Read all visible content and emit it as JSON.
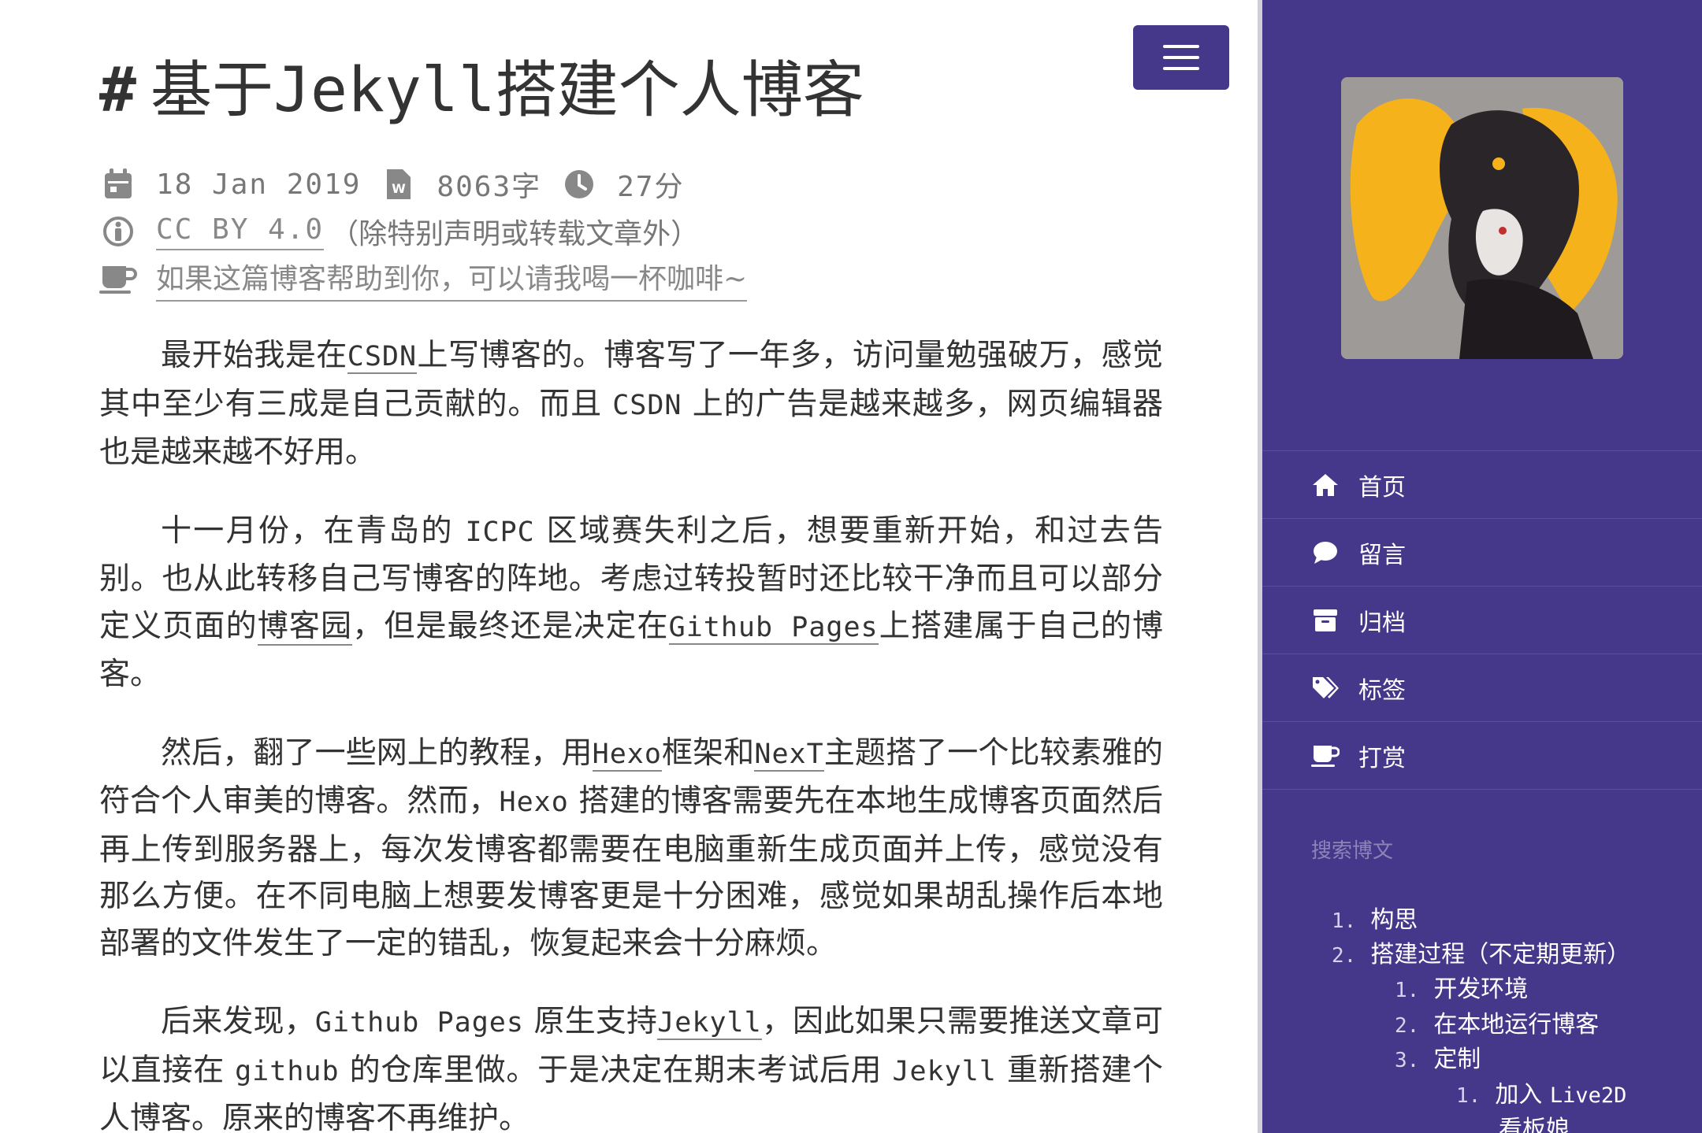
{
  "menu": {
    "icon": "hamburger-icon"
  },
  "article": {
    "title_hash": "#",
    "title_pre": "基于",
    "title_mono": "Jekyll",
    "title_post": "搭建个人博客",
    "date": "18 Jan 2019",
    "words": "8063字",
    "read_time": "27分",
    "license": "CC BY 4.0",
    "license_note": "（除特别声明或转载文章外）",
    "donate_text": "如果这篇博客帮助到你，可以请我喝一杯咖啡~",
    "p1": {
      "a": "最开始我是在",
      "link_csdn": "CSDN",
      "b": "上写博客的。博客写了一年多，访问量勉强破万，感觉其中至少有三成是自己贡献的。而且 ",
      "m1": "CSDN",
      "c": " 上的广告是越来越多，网页编辑器也是越来越不好用。"
    },
    "p2": {
      "a": "十一月份，在青岛的 ",
      "m1": "ICPC",
      "b": " 区域赛失利之后，想要重新开始，和过去告别。也从此转移自己写博客的阵地。考虑过转投暂时还比较干净而且可以部分定义页面的",
      "link_cnblogs": "博客园",
      "c": "，但是最终还是决定在",
      "link_pages": "Github Pages",
      "d": "上搭建属于自己的博客。"
    },
    "p3": {
      "a": "然后，翻了一些网上的教程，用",
      "link_hexo": "Hexo",
      "b": "框架和",
      "link_next": "NexT",
      "c": "主题搭了一个比较素雅的符合个人审美的博客。然而，",
      "m1": "Hexo",
      "d": " 搭建的博客需要先在本地生成博客页面然后再上传到服务器上，每次发博客都需要在电脑重新生成页面并上传，感觉没有那么方便。在不同电脑上想要发博客更是十分困难，感觉如果胡乱操作后本地部署的文件发生了一定的错乱，恢复起来会十分麻烦。"
    },
    "p4": {
      "a": "后来发现，",
      "m1": "Github Pages",
      "b": " 原生支持",
      "link_jekyll": "Jekyll",
      "c": "，因此如果只需要推送文章可以直接在 ",
      "m2": "github",
      "d": " 的仓库里做。于是决定在期末考试后用 ",
      "m3": "Jekyll",
      "e": " 重新搭建个人博客。原来的博客不再维护。"
    }
  },
  "sidebar": {
    "nav": [
      {
        "label": "首页",
        "icon": "home-icon"
      },
      {
        "label": "留言",
        "icon": "comment-icon"
      },
      {
        "label": "归档",
        "icon": "archive-icon"
      },
      {
        "label": "标签",
        "icon": "tags-icon"
      },
      {
        "label": "打赏",
        "icon": "coffee-icon"
      }
    ],
    "search_label": "搜索博文",
    "toc": [
      {
        "num": "1.",
        "label": "构思"
      },
      {
        "num": "2.",
        "label": "搭建过程（不定期更新）"
      },
      {
        "num": "1.",
        "label": "开发环境"
      },
      {
        "num": "2.",
        "label": "在本地运行博客"
      },
      {
        "num": "3.",
        "label": "定制"
      },
      {
        "num": "1.",
        "label_a": "加入 ",
        "label_m": "Live2D",
        "label_b": "看板娘"
      }
    ]
  },
  "colors": {
    "accent": "#45378a",
    "text": "#333333",
    "meta": "#777777"
  }
}
